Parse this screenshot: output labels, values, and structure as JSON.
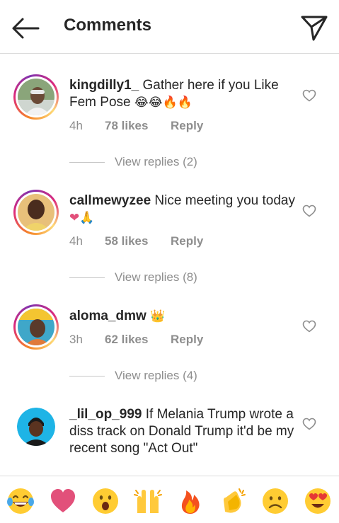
{
  "header": {
    "title": "Comments",
    "back_icon": "arrow-left-icon",
    "send_icon": "paper-plane-icon"
  },
  "comments": [
    {
      "username": "kingdilly1_",
      "text": " Gather here if you Like Fem Pose ",
      "emojis": "😂😂🔥🔥",
      "time": "4h",
      "likes": "78 likes",
      "reply": "Reply",
      "view_replies": "View replies (2)",
      "story_ring": true
    },
    {
      "username": "callmewyzee",
      "text": " Nice meeting you today ",
      "emojis": "❤🙏",
      "time": "4h",
      "likes": "58 likes",
      "reply": "Reply",
      "view_replies": "View replies (8)",
      "story_ring": true
    },
    {
      "username": "aloma_dmw",
      "text": " ",
      "emojis": "👑",
      "time": "3h",
      "likes": "62 likes",
      "reply": "Reply",
      "view_replies": "View replies (4)",
      "story_ring": true
    },
    {
      "username": "_lil_op_999",
      "text": " If Melania Trump wrote a diss track on Donald Trump it'd be my recent song \"Act Out\"",
      "emojis": "",
      "story_ring": false
    }
  ],
  "emoji_bar": [
    "😂",
    "❤️",
    "😮",
    "🙌",
    "🔥",
    "👏",
    "😢",
    "😍"
  ],
  "colors": {
    "text": "#262626",
    "muted": "#8e8e8e",
    "divider": "#dbdbdb",
    "heart": "#ed4956"
  }
}
